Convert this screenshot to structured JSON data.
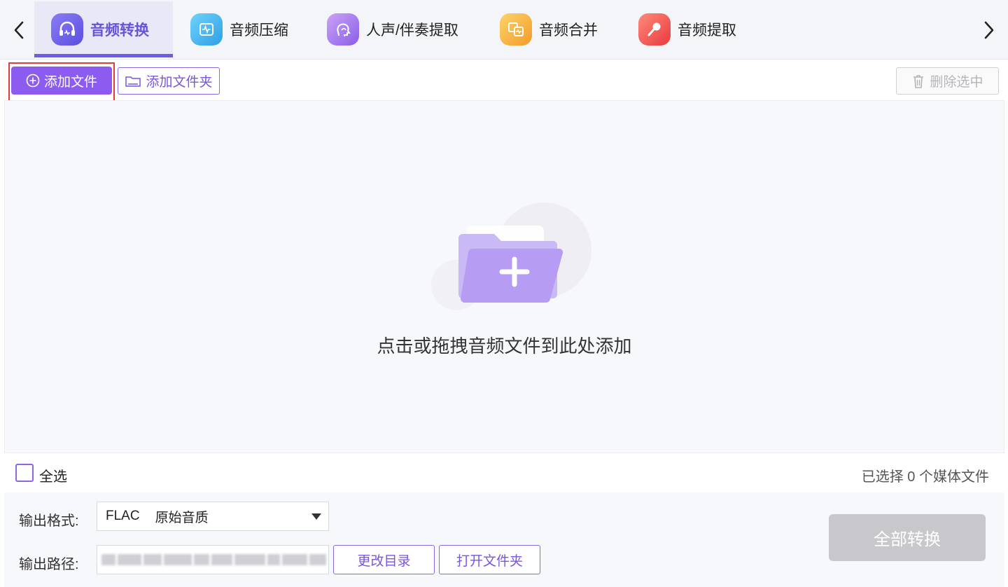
{
  "tabs": [
    {
      "label": "音频转换",
      "icon": "headphones-icon",
      "active": true,
      "color": "#7c6cf0"
    },
    {
      "label": "音频压缩",
      "icon": "waveform-icon",
      "active": false,
      "color": "#3fb6ee"
    },
    {
      "label": "人声/伴奏提取",
      "icon": "voice-profile-icon",
      "active": false,
      "color": "#a97cf0"
    },
    {
      "label": "音频合并",
      "icon": "merge-icon",
      "active": false,
      "color": "#f5b53a"
    },
    {
      "label": "音频提取",
      "icon": "microphone-icon",
      "active": false,
      "color": "#f0504c"
    }
  ],
  "toolbar": {
    "add_file": "添加文件",
    "add_folder": "添加文件夹",
    "delete_selected": "删除选中"
  },
  "drop_area": {
    "hint": "点击或拖拽音频文件到此处添加"
  },
  "selection": {
    "select_all": "全选",
    "selected_count_text": "已选择 0 个媒体文件"
  },
  "output": {
    "format_label": "输出格式:",
    "format_value": "FLAC",
    "format_quality": "原始音质",
    "path_label": "输出路径:",
    "change_dir": "更改目录",
    "open_folder": "打开文件夹"
  },
  "convert_all": "全部转换",
  "colors": {
    "accent": "#8c5cf0",
    "annotation_red": "#e53b3b",
    "disabled": "#c8c8cc"
  }
}
